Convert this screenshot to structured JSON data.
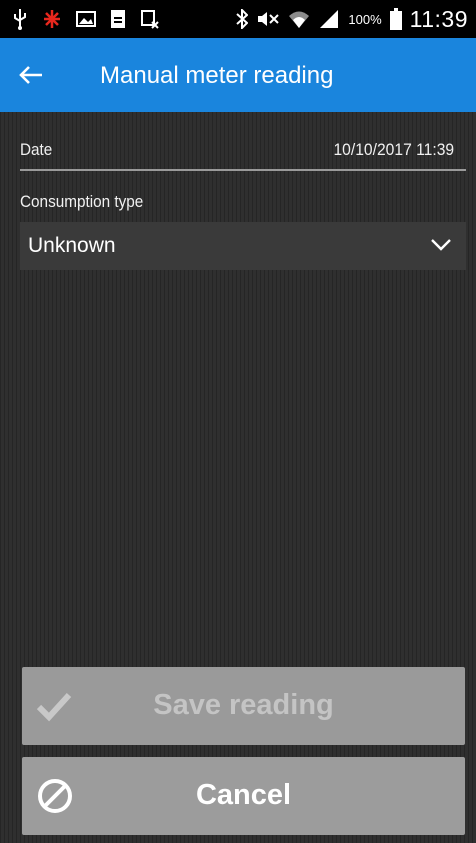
{
  "status_bar": {
    "battery_percent": "100%",
    "time": "11:39",
    "icons": [
      "usb-icon",
      "debug-icon",
      "image-icon",
      "sim-icon",
      "sync-off-icon",
      "bluetooth-icon",
      "mute-icon",
      "wifi-icon",
      "signal-icon",
      "battery-icon"
    ]
  },
  "app_bar": {
    "title": "Manual meter reading",
    "back_icon": "arrow-left-icon",
    "color": "#1a85dd"
  },
  "form": {
    "date_label": "Date",
    "date_value": "10/10/2017 11:39",
    "consumption_label": "Consumption type",
    "consumption_value": "Unknown"
  },
  "buttons": {
    "save_label": "Save reading",
    "save_enabled": false,
    "cancel_label": "Cancel"
  }
}
